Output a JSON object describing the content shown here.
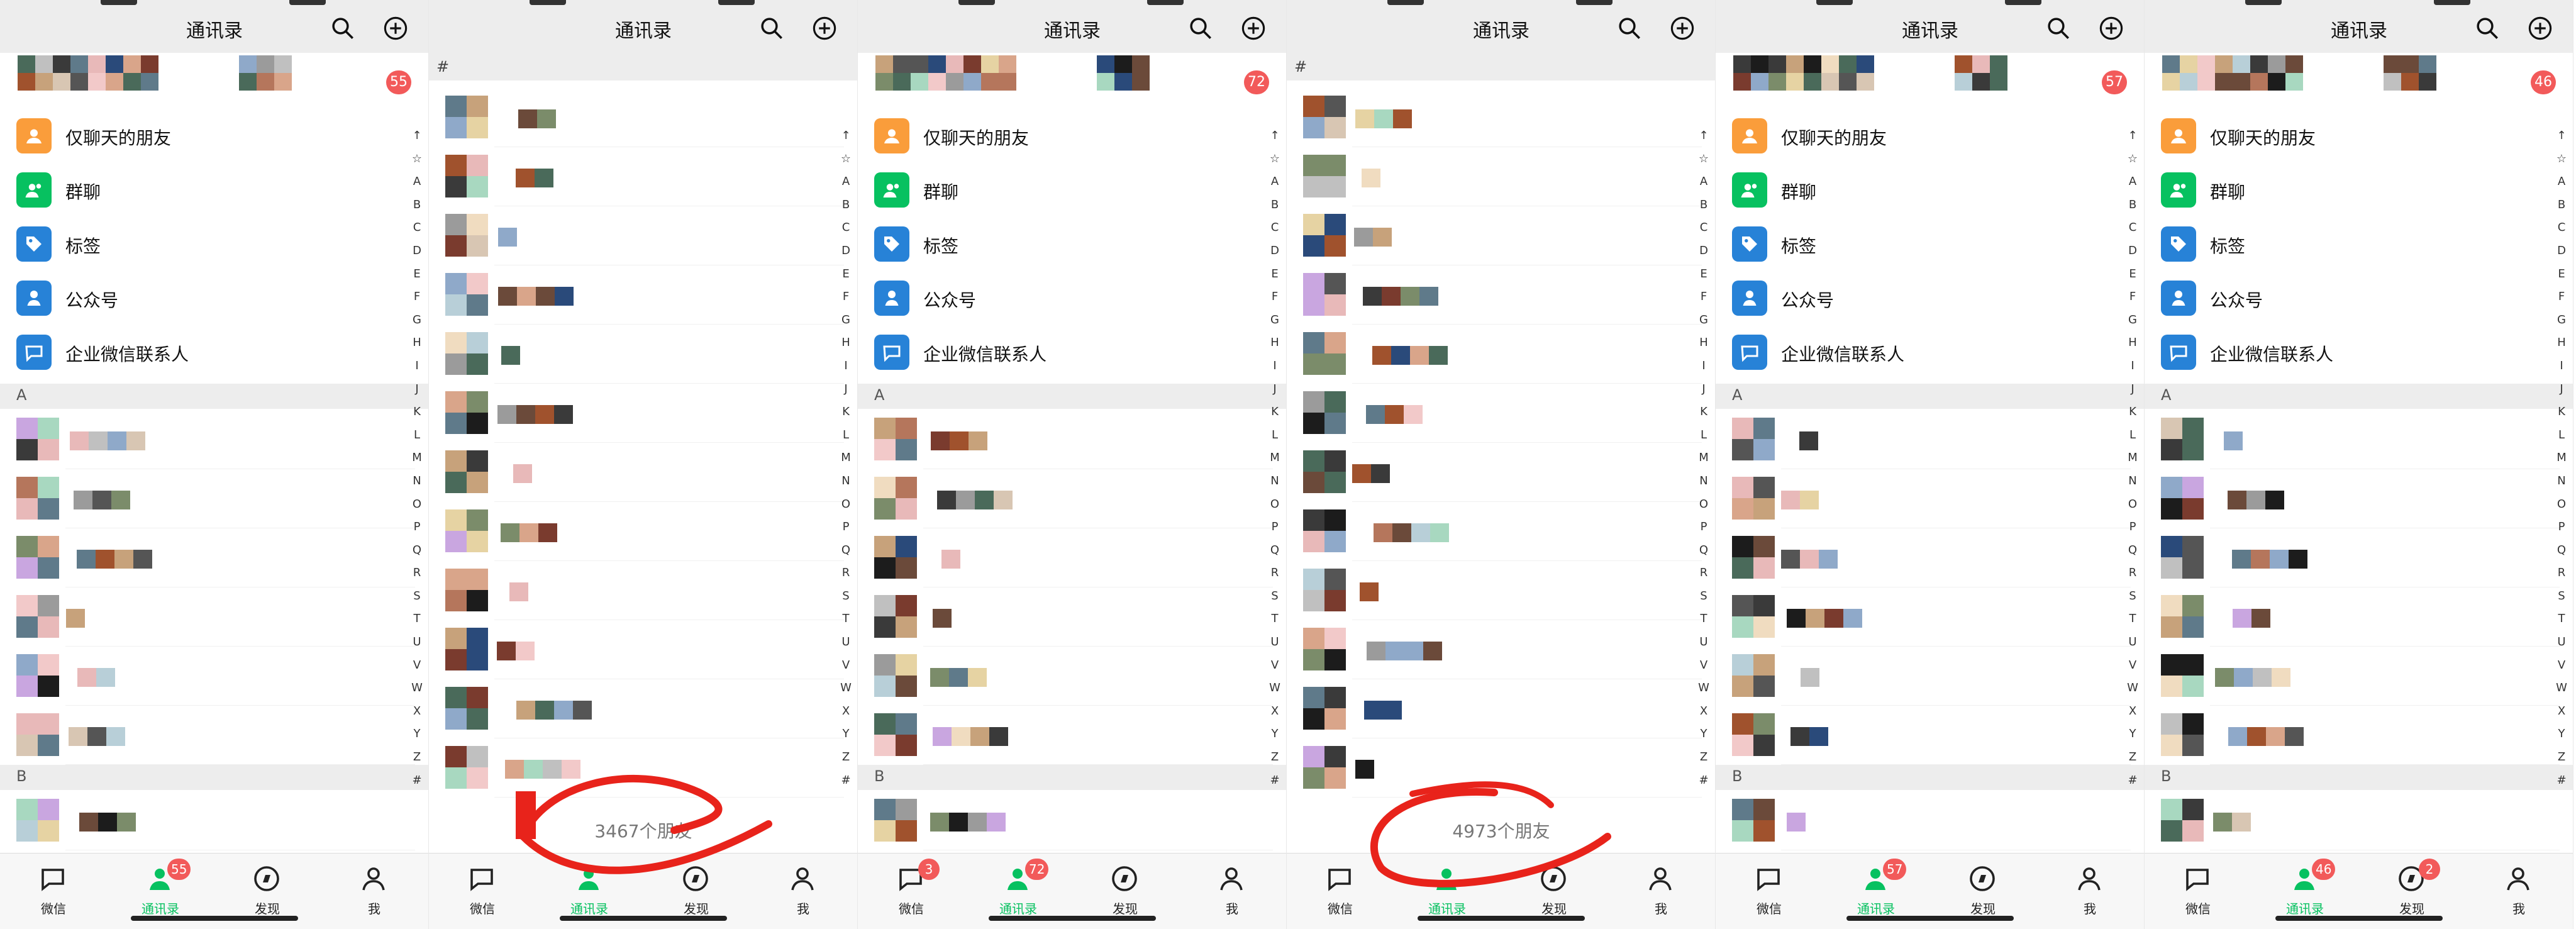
{
  "header": {
    "title": "通讯录"
  },
  "function_rows": [
    {
      "label": "仅聊天的朋友",
      "icon": "only-chat-friends-icon",
      "color": "#fa9d3b"
    },
    {
      "label": "群聊",
      "icon": "group-chat-icon",
      "color": "#07c160"
    },
    {
      "label": "标签",
      "icon": "tag-icon",
      "color": "#2782d7"
    },
    {
      "label": "公众号",
      "icon": "official-account-icon",
      "color": "#2782d7"
    },
    {
      "label": "企业微信联系人",
      "icon": "wecom-contact-icon",
      "color": "#2782d7"
    }
  ],
  "index_letters": [
    "↑",
    "☆",
    "A",
    "B",
    "C",
    "D",
    "E",
    "F",
    "G",
    "H",
    "I",
    "J",
    "K",
    "L",
    "M",
    "N",
    "O",
    "P",
    "Q",
    "R",
    "S",
    "T",
    "U",
    "V",
    "W",
    "X",
    "Y",
    "Z",
    "#"
  ],
  "hash_header": "#",
  "section_letters": {
    "A": "A",
    "B": "B"
  },
  "tabs": [
    {
      "label": "微信",
      "icon": "chat-bubble-icon"
    },
    {
      "label": "通讯录",
      "icon": "contacts-icon"
    },
    {
      "label": "发现",
      "icon": "discover-compass-icon"
    },
    {
      "label": "我",
      "icon": "profile-icon"
    }
  ],
  "panels": [
    {
      "top_badge": "55",
      "tab_badges": {
        "chat": "",
        "contacts": "55",
        "discover": ""
      }
    },
    {
      "friend_count": "3467个朋友"
    },
    {
      "top_badge": "72",
      "tab_badges": {
        "chat": "3",
        "contacts": "72",
        "discover": ""
      }
    },
    {
      "friend_count": "4973个朋友"
    },
    {
      "top_badge": "57",
      "tab_badges": {
        "chat": "",
        "contacts": "57",
        "discover": ""
      }
    },
    {
      "top_badge": "46",
      "tab_badges": {
        "chat": "",
        "contacts": "46",
        "discover": "2"
      }
    }
  ],
  "colors": {
    "accent": "#07c160",
    "badge": "#f25a5a",
    "annotation": "#e8231b",
    "header_bg": "#ededed"
  }
}
